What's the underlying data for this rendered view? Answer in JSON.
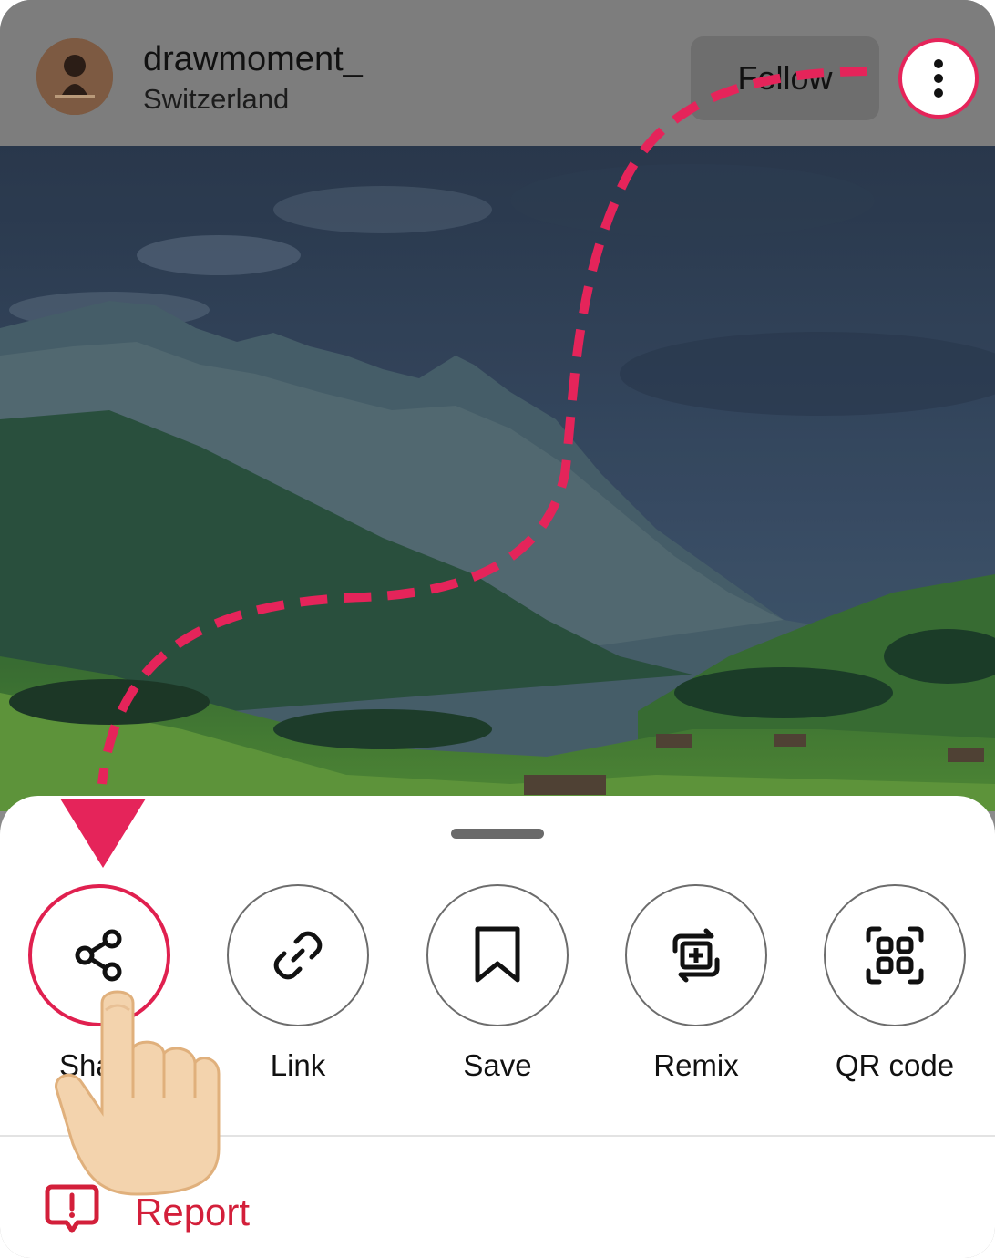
{
  "header": {
    "username": "drawmoment_",
    "location": "Switzerland",
    "follow_label": "Follow"
  },
  "actions": [
    {
      "label": "Share",
      "icon": "share-icon"
    },
    {
      "label": "Link",
      "icon": "link-icon"
    },
    {
      "label": "Save",
      "icon": "bookmark-icon"
    },
    {
      "label": "Remix",
      "icon": "remix-icon"
    },
    {
      "label": "QR code",
      "icon": "qr-code-icon"
    }
  ],
  "report": {
    "label": "Report",
    "icon": "report-icon"
  },
  "colors": {
    "highlight": "#e5245a",
    "report": "#d31f3a"
  }
}
